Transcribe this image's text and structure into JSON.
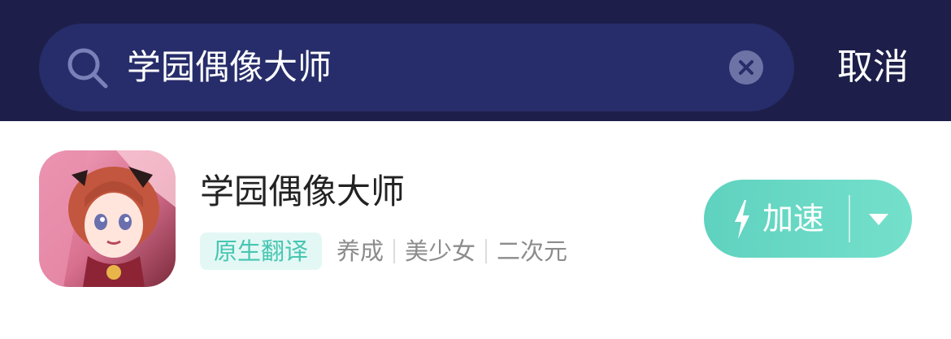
{
  "search": {
    "query": "学园偶像大师",
    "cancel_label": "取消",
    "search_icon": "search-icon",
    "clear_icon": "clear-icon"
  },
  "result": {
    "title": "学园偶像大师",
    "highlight_tag": "原生翻译",
    "tags": [
      "养成",
      "美少女",
      "二次元"
    ],
    "action": {
      "label": "加速",
      "icon": "lightning-bolt-icon",
      "dropdown_icon": "chevron-down-icon"
    }
  },
  "colors": {
    "header_bg": "#1d1f4a",
    "search_bg": "#272d6a",
    "accent": "#5fd2bf",
    "tag_bg": "#e3f8f4",
    "tag_text": "#47c6b2"
  }
}
